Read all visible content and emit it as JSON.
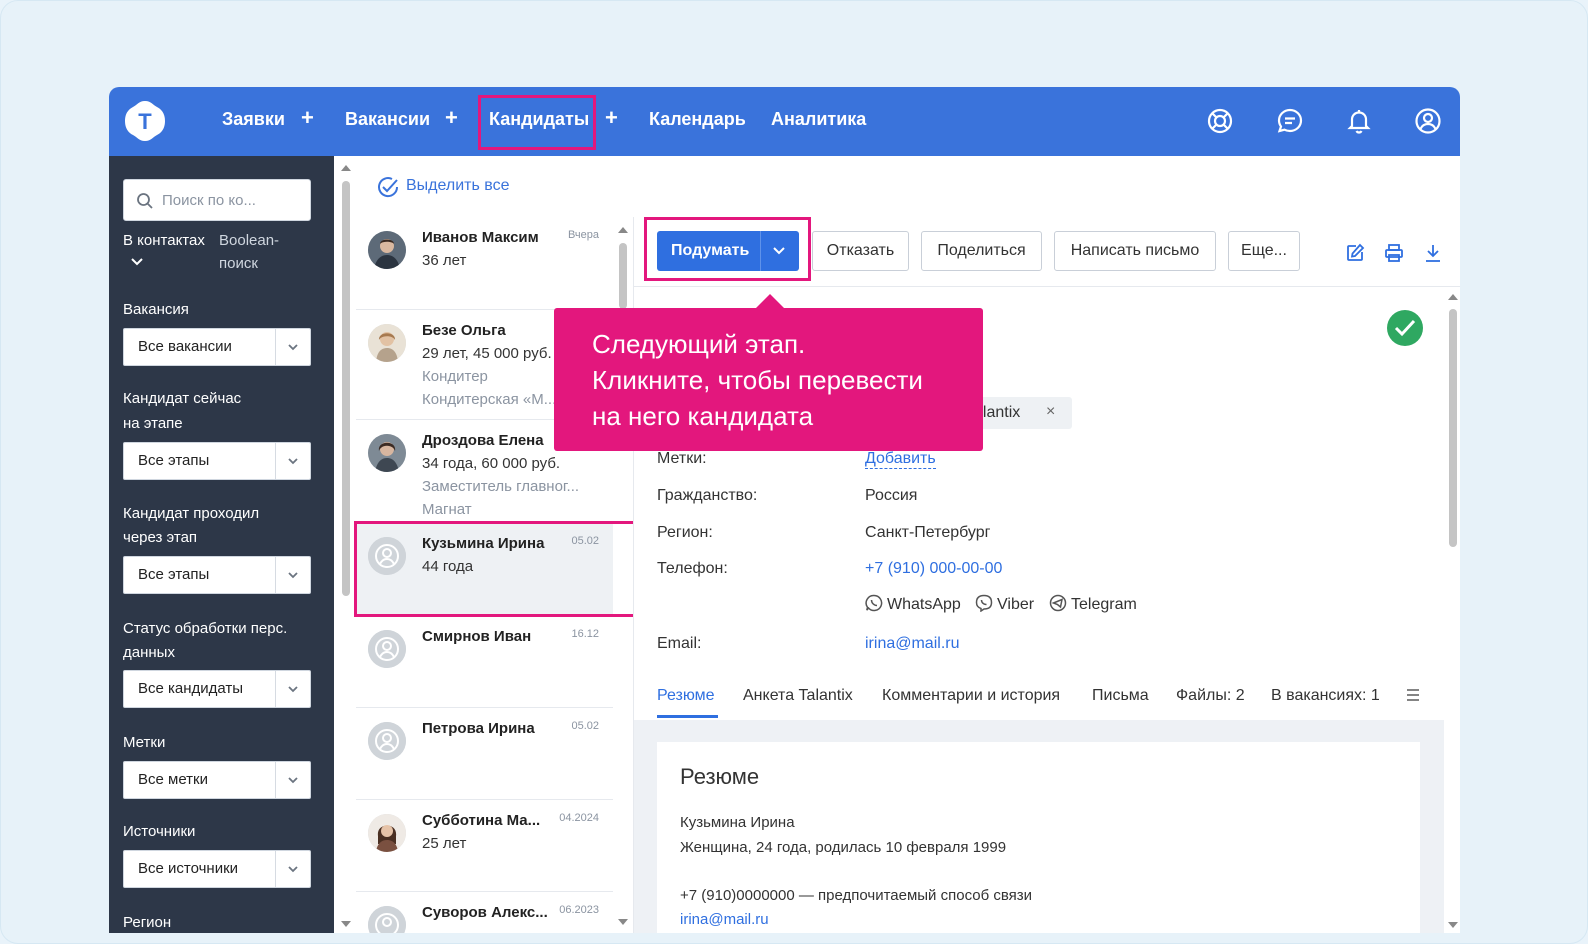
{
  "nav": {
    "items": [
      "Заявки",
      "Вакансии",
      "Кандидаты",
      "Календарь",
      "Аналитика"
    ],
    "logo_letter": "T"
  },
  "sidebar": {
    "search_placeholder": "Поиск по ко...",
    "in_contacts": "В контактах",
    "boolean_line1": "Boolean-",
    "boolean_line2": "поиск",
    "filters": [
      {
        "label_lines": [
          "Вакансия"
        ],
        "value": "Все вакансии"
      },
      {
        "label_lines": [
          "Кандидат сейчас",
          "на этапе"
        ],
        "value": "Все этапы"
      },
      {
        "label_lines": [
          "Кандидат проходил",
          "через этап"
        ],
        "value": "Все этапы"
      },
      {
        "label_lines": [
          "Статус обработки перс.",
          "данных"
        ],
        "value": "Все кандидаты"
      },
      {
        "label_lines": [
          "Метки"
        ],
        "value": "Все метки"
      },
      {
        "label_lines": [
          "Источники"
        ],
        "value": "Все источники"
      },
      {
        "label_lines": [
          "Регион"
        ],
        "value": ""
      }
    ]
  },
  "list": {
    "select_all": "Выделить все",
    "candidates": [
      {
        "name": "Иванов Максим",
        "date": "Вчера",
        "lines": [
          "36 лет"
        ],
        "muted": []
      },
      {
        "name": "Безе Ольга",
        "date": "",
        "lines": [
          "29 лет, 45 000 руб."
        ],
        "muted": [
          "Кондитер",
          "Кондитерская «М..."
        ]
      },
      {
        "name": "Дроздова Елена",
        "date": "",
        "lines": [
          "34 года, 60 000 руб."
        ],
        "muted": [
          "Заместитель главног...",
          "Магнат"
        ]
      },
      {
        "name": "Кузьмина Ирина",
        "date": "05.02",
        "lines": [
          "44 года"
        ],
        "muted": []
      },
      {
        "name": "Смирнов Иван",
        "date": "16.12",
        "lines": [],
        "muted": []
      },
      {
        "name": "Петрова Ирина",
        "date": "05.02",
        "lines": [],
        "muted": []
      },
      {
        "name": "Субботина Ма...",
        "date": "04.2024",
        "lines": [
          "25 лет"
        ],
        "muted": []
      },
      {
        "name": "Суворов Алекс...",
        "date": "06.2023",
        "lines": [],
        "muted": []
      }
    ]
  },
  "toolbar": {
    "primary": "Подумать",
    "reject": "Отказать",
    "share": "Поделиться",
    "write": "Написать письмо",
    "more": "Еще..."
  },
  "details": {
    "tag_chip": "alantix",
    "labels": {
      "tags": "Метки:",
      "citizenship": "Гражданство:",
      "region": "Регион:",
      "phone": "Телефон:",
      "email": "Email:"
    },
    "tags_action": "Добавить",
    "citizenship": "Россия",
    "region": "Санкт-Петербург",
    "phone": "+7 (910) 000-00-00",
    "messengers": [
      "WhatsApp",
      "Viber",
      "Telegram"
    ],
    "email": "irina@mail.ru"
  },
  "tabs": [
    "Резюме",
    "Анкета Talantix",
    "Комментарии и история",
    "Письма",
    "Файлы: 2",
    "В вакансиях: 1"
  ],
  "resume": {
    "title": "Резюме",
    "lines": [
      "Кузьмина Ирина",
      "Женщина, 24 года, родилась 10 февраля 1999",
      "+7 (910)0000000 — предпочитаемый способ связи",
      "irina@mail.ru"
    ]
  },
  "tooltip": {
    "lines": [
      "Следующий этап.",
      "Кликните, чтобы перевести",
      "на него кандидата"
    ]
  },
  "colors": {
    "brand": "#3a73db",
    "primary_button": "#2f6fe0",
    "highlight": "#e3177d",
    "sidebar": "#2d3748",
    "success": "#2fa861"
  }
}
